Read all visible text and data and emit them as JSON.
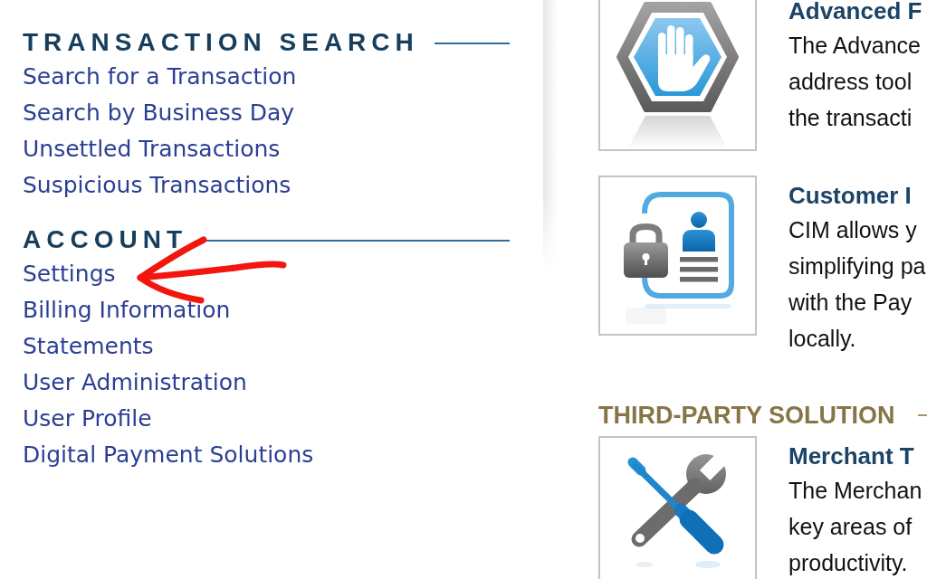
{
  "sidebar": {
    "sections": [
      {
        "title": "TRANSACTION SEARCH",
        "links": [
          "Search for a Transaction",
          "Search by Business Day",
          "Unsettled Transactions",
          "Suspicious Transactions"
        ]
      },
      {
        "title": "ACCOUNT",
        "links": [
          "Settings",
          "Billing Information",
          "Statements",
          "User Administration",
          "User Profile",
          "Digital Payment Solutions"
        ]
      }
    ]
  },
  "features": [
    {
      "kind": "hand",
      "title": "Advanced F",
      "lines": [
        "The Advance",
        "address tool",
        "the transacti"
      ]
    },
    {
      "kind": "lock-card",
      "title": "Customer I",
      "lines": [
        "CIM allows y",
        "simplifying pa",
        "with the Pay",
        "locally."
      ]
    }
  ],
  "third_party": {
    "title": "THIRD-PARTY SOLUTION",
    "features": [
      {
        "kind": "tools",
        "title": "Merchant T",
        "lines": [
          "The Merchan",
          "key areas of",
          "productivity."
        ]
      }
    ]
  }
}
